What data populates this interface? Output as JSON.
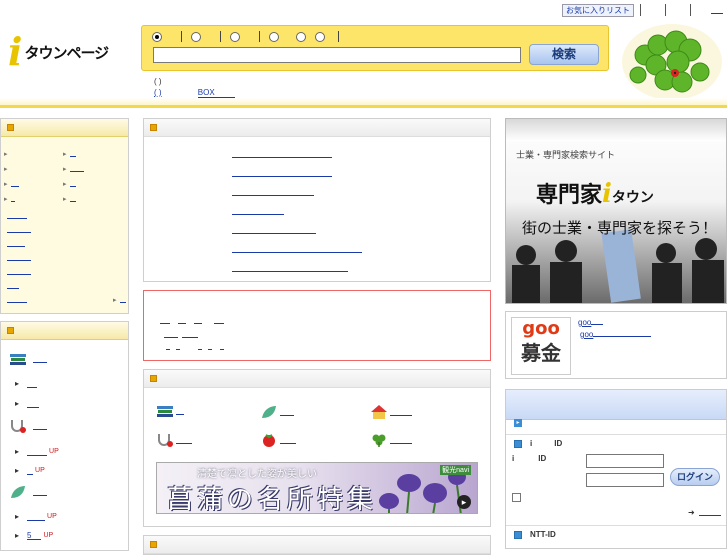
{
  "header": {
    "favorites_label": "お気に入りリスト",
    "logo_mark": "i",
    "logo_text": "タウンページ",
    "search_button": "検索",
    "sublink_1": "(   )",
    "sublink_2": "(   )",
    "sublink_box": "BOX"
  },
  "banner_mid": {
    "small_text": "清楚で凛とした姿が美しい",
    "big_text": "菖蒲の名所特集",
    "tag": "観光navi"
  },
  "left": {
    "up_badges": [
      "UP",
      "UP",
      "UP",
      "UP"
    ],
    "link_5": "5"
  },
  "ad": {
    "line1": "士業・専門家検索サイト",
    "line2_a": "専門家",
    "line2_mark": "i",
    "line2_b": "タウン",
    "line3": "街の士業・専門家を探そう！"
  },
  "goo": {
    "logo_top": "goo",
    "logo_bottom": "募金",
    "link1": "goo",
    "link2": "goo"
  },
  "login": {
    "row1_a": "i",
    "row1_b": "ID",
    "row2_a": "i",
    "row2_b": "ID",
    "button": "ログイン",
    "arrow": "➜",
    "ntt": "NTT-ID"
  }
}
